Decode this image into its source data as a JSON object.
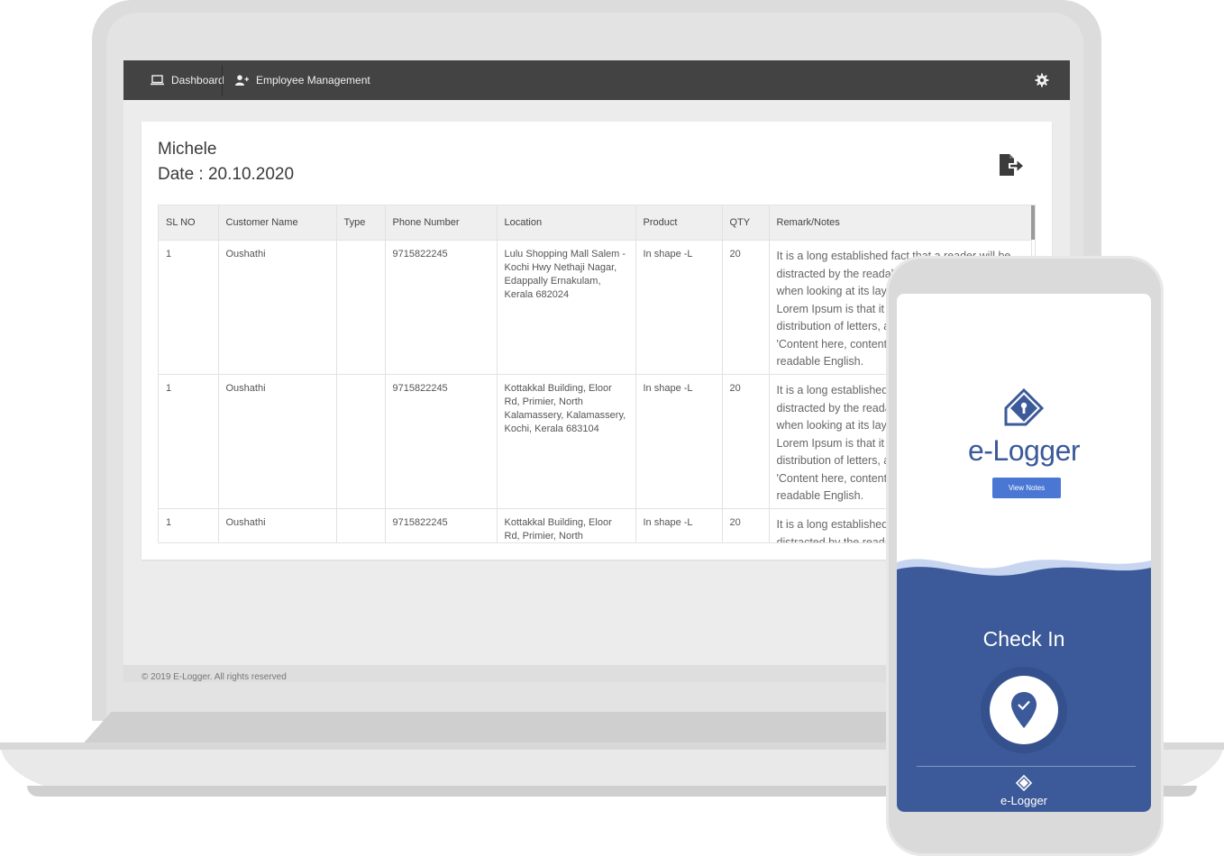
{
  "nav": {
    "dashboard_label": "Dashboard",
    "employee_label": "Employee Management",
    "dashboard_icon": "laptop-icon",
    "employee_icon": "user-add-icon",
    "settings_icon": "gear-icon"
  },
  "card": {
    "name": "Michele",
    "date": "Date : 20.10.2020",
    "export_icon": "export-file-icon"
  },
  "table": {
    "columns": [
      "SL NO",
      "Customer Name",
      "Type",
      "Phone Number",
      "Location",
      "Product",
      "QTY",
      "Remark/Notes"
    ],
    "rows": [
      {
        "sl": "1",
        "customer": "Oushathi",
        "type": "",
        "phone": "9715822245",
        "location": "Lulu Shopping Mall Salem - Kochi Hwy Nethaji Nagar, Edappally Ernakulam, Kerala 682024",
        "product": "In shape -L",
        "qty": "20",
        "notes": "It is a long established fact that a reader will be distracted by the readable content of a page when looking at its layout. The point of using Lorem Ipsum is that it has a more-or-less normal distribution of letters, as opposed to using 'Content here, content here', making it look like readable English."
      },
      {
        "sl": "1",
        "customer": "Oushathi",
        "type": "",
        "phone": "9715822245",
        "location": "Kottakkal Building, Eloor Rd, Primier, North Kalamassery, Kalamassery, Kochi, Kerala 683104",
        "product": "In shape -L",
        "qty": "20",
        "notes": "It is a long established fact that a reader will be distracted by the readable content of a page when looking at its layout. The point of using Lorem Ipsum is that it has a more-or-less normal distribution of letters, as opposed to using 'Content here, content here', making it look like readable English."
      },
      {
        "sl": "1",
        "customer": "Oushathi",
        "type": "",
        "phone": "9715822245",
        "location": "Kottakkal Building, Eloor Rd, Primier, North Kalamassery,",
        "product": "In shape -L",
        "qty": "20",
        "notes": "It is a long established fact that a reader will be distracted by the readable content of a page"
      }
    ]
  },
  "footer": {
    "text": "© 2019 E-Logger. All rights reserved"
  },
  "phone": {
    "logo_text": "e-Logger",
    "view_notes_label": "View Notes",
    "check_in_label": "Check In",
    "mini_logo_text": "e-Logger",
    "colors": {
      "brand": "#3c5a99",
      "button": "#4a77d4"
    }
  }
}
